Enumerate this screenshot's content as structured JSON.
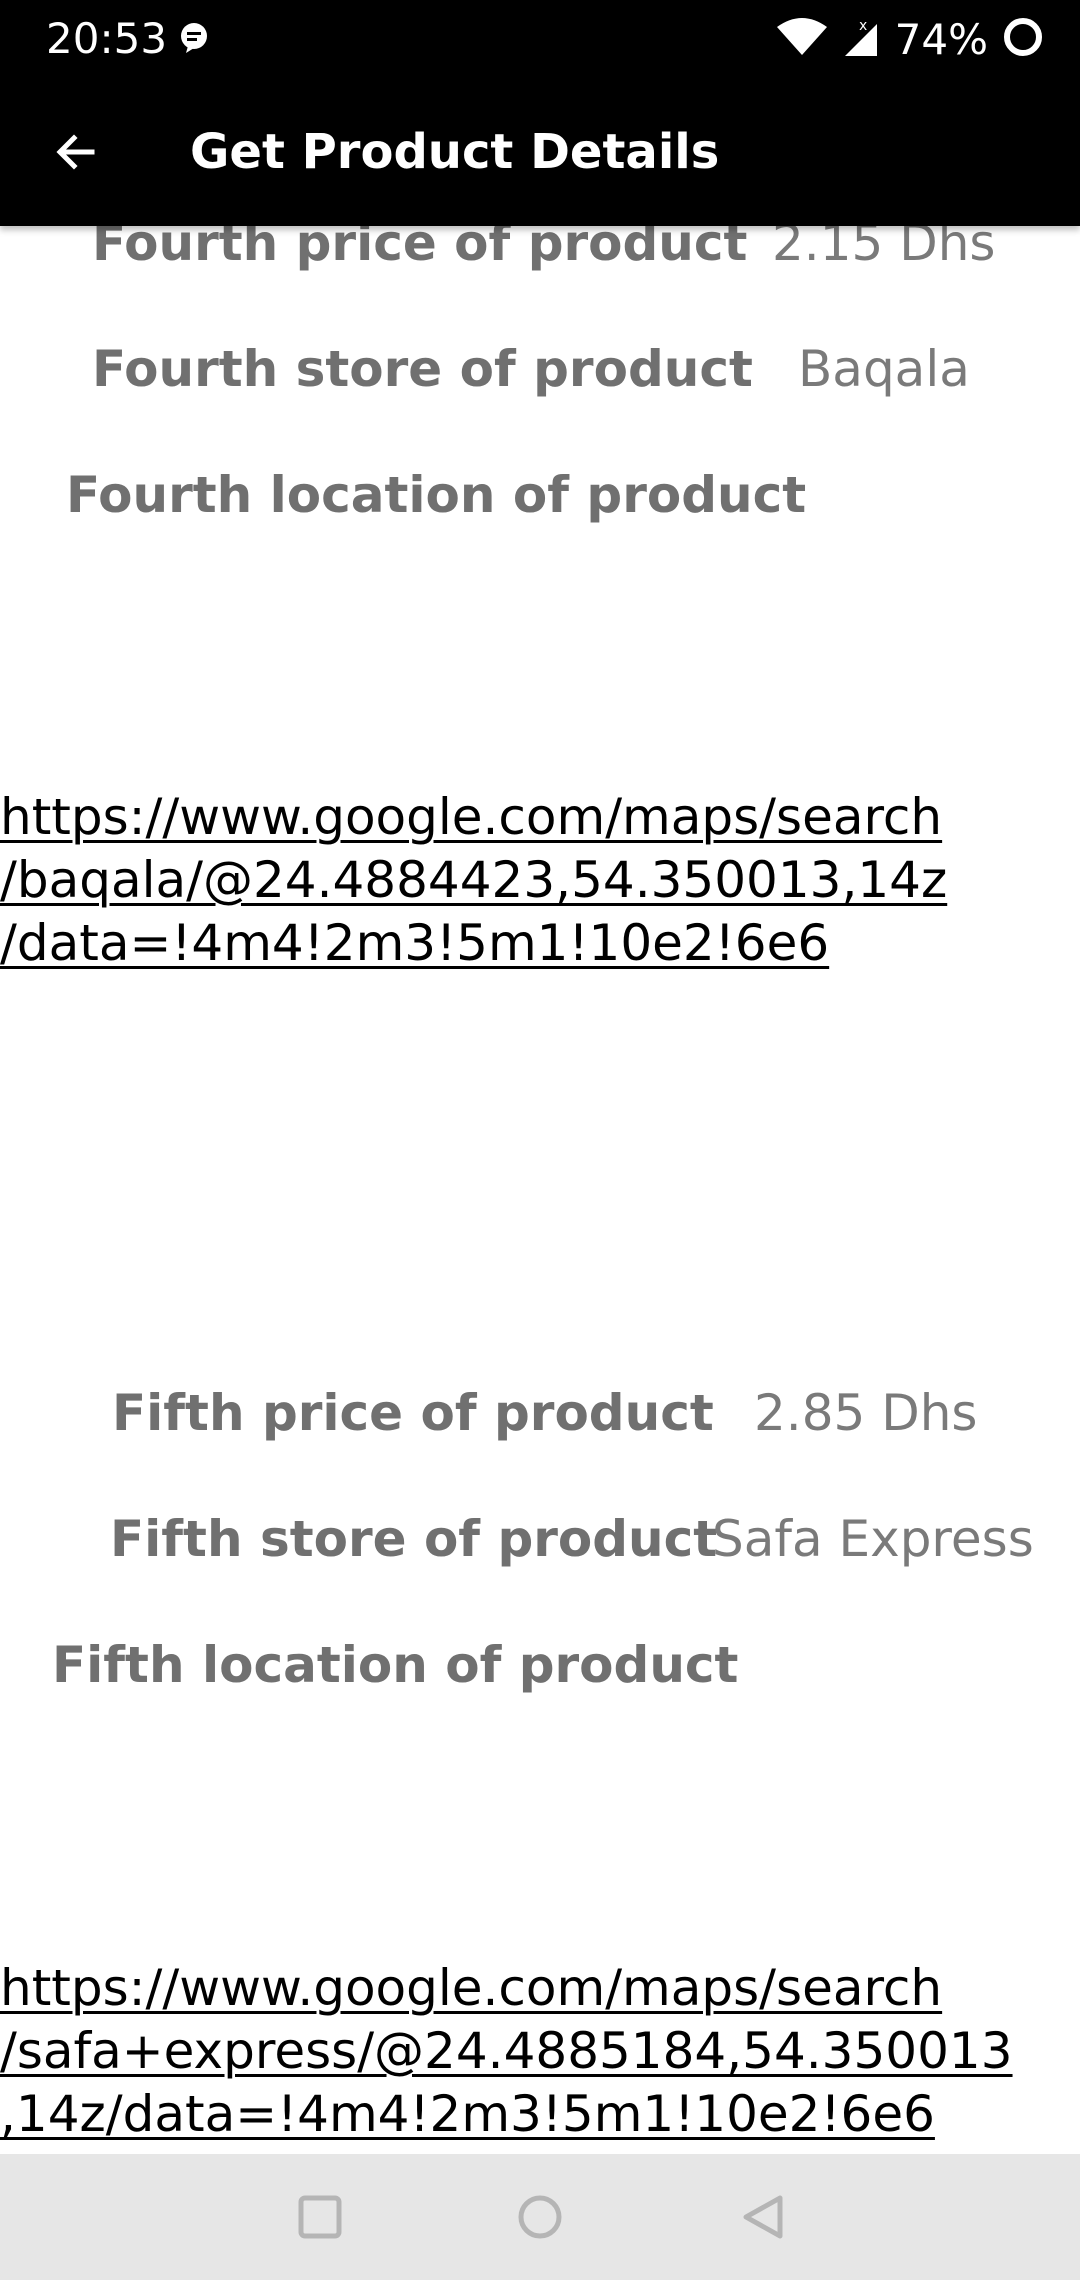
{
  "status_bar": {
    "time": "20:53",
    "battery": "74%",
    "icons": [
      "chat-notification-icon",
      "wifi-icon",
      "cell-signal-icon",
      "battery-icon"
    ]
  },
  "app_bar": {
    "title": "Get Product Details",
    "back_icon": "arrow-left-icon"
  },
  "fourth": {
    "price_label": "Fourth price of product",
    "price_value": "2.15 Dhs",
    "store_label": "Fourth store of product",
    "store_value": "Baqala",
    "location_label": "Fourth location of product",
    "location_link": "https://www.google.com/maps/search\n/baqala/@24.4884423,54.350013,14z\n/data=!4m4!2m3!5m1!10e2!6e6"
  },
  "fifth": {
    "price_label": "Fifth price of product",
    "price_value": "2.85 Dhs",
    "store_label": "Fifth store of product",
    "store_value": "Safa Express",
    "location_label": "Fifth location of product",
    "location_link": "https://www.google.com/maps/search\n/safa+express/@24.4885184,54.350013\n,14z/data=!4m4!2m3!5m1!10e2!6e6"
  },
  "nav_bar": {
    "icons": [
      "recents-square-icon",
      "home-circle-icon",
      "back-triangle-icon"
    ]
  },
  "colors": {
    "bar_background": "#000000",
    "label_gray": "#707070",
    "nav_background": "#e6e6e6"
  }
}
